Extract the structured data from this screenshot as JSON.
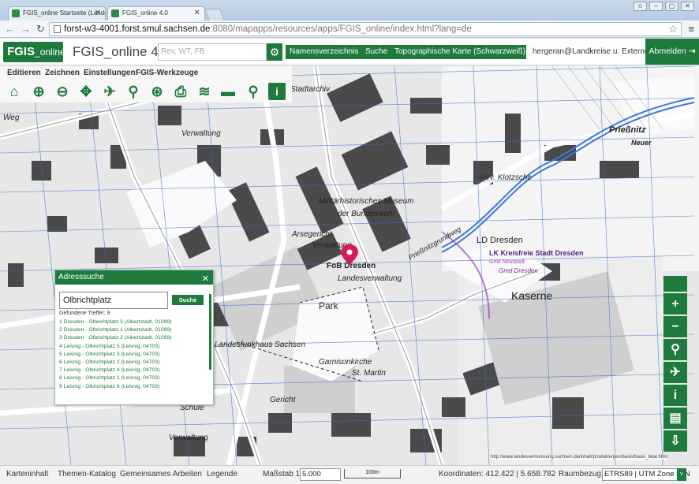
{
  "browser": {
    "tabs": [
      {
        "title": "FGIS_online Startseite (Landes",
        "active": false
      },
      {
        "title": "FGIS_online 4.0",
        "active": true
      }
    ],
    "url_host": "forst-w3-4001.forst.smul.sachsen.de",
    "url_path": ":8080/mapapps/resources/apps/FGIS_online/index.html?lang=de",
    "window_buttons": [
      "person-icon",
      "minimize-icon",
      "maximize-icon",
      "close-icon"
    ]
  },
  "header": {
    "logo_main": "FGIS",
    "logo_sub": "_online",
    "app_title": "FGIS_online 4.0",
    "search_placeholder": "Rev, WT, FB",
    "namensverzeichnis_label": "Namensverzeichnis",
    "suche_label": "Suche",
    "basemap_label": "Topographische Karte (Schwarzweiß)",
    "user": "hergeran@Landkreise u. Externe",
    "logout_label": "Abmelden"
  },
  "menu": {
    "items": [
      "Editieren",
      "Zeichnen",
      "Einstellungen",
      "FGIS-Werkzeuge"
    ]
  },
  "toolbar": {
    "tools": [
      "home-icon",
      "zoom-in-box-icon",
      "zoom-out-box-icon",
      "pan-icon",
      "extent-icon",
      "magnify-icon",
      "zoom-full-icon",
      "print-icon",
      "layers-add-icon",
      "measure-icon",
      "search-map-icon",
      "info-icon"
    ]
  },
  "map": {
    "labels": [
      "Weg",
      "Verwaltung",
      "Stadtarchiv",
      "Militärhistorisches Museum",
      "der Bundeswehr",
      "Arsegericht",
      "Verwaltung",
      "FoB Dresden",
      "Landesverwaltung",
      "Park",
      "Rev. Klotzsche",
      "LD Dresden",
      "LK Kreisfreie Stadt Dresden",
      "Gmk Neustadt",
      "Gmd Dresden",
      "Kaserne",
      "Prießnitz",
      "Neuer",
      "Garnisonkirche",
      "St. Martin",
      "Gericht",
      "Schule",
      "Verwaltung",
      "Landesfunkhaus Sachsen",
      "Prießnitzgrundweg"
    ],
    "marker_label": "FoB Dresden"
  },
  "zoom_controls": [
    "zoom-in-icon",
    "zoom-out-icon",
    "zoom-search-icon",
    "pan-map-icon",
    "info-map-icon",
    "identify-icon",
    "download-icon"
  ],
  "zoom_labels": [
    "+",
    "−"
  ],
  "address_search": {
    "title": "Adresssuche",
    "input_value": "Olbrichtplatz",
    "search_label": "Suche",
    "found_label": "Gefundene Treffer: 9",
    "results": [
      "1 Dresden - Olbrichtplatz 3 (Albertstadt, 01099)",
      "2 Dresden - Olbrichtplatz 1 (Albertstadt, 01099)",
      "3 Dresden - Olbrichtplatz 2 (Albertstadt, 01099)",
      "4 Leisnig - Olbrichtplatz 5 (Leisnig, 04703)",
      "5 Leisnig - Olbrichtplatz 3 (Leisnig, 04703)",
      "6 Leisnig - Olbrichtplatz 2 (Leisnig, 04703)",
      "7 Leisnig - Olbrichtplatz 4 (Leisnig, 04703)",
      "8 Leisnig - Olbrichtplatz 1 (Leisnig, 04703)",
      "9 Leisnig - Olbrichtplatz 6 (Leisnig, 04703)"
    ]
  },
  "statusbar": {
    "items": [
      "Karteninhalt",
      "Themen-Katalog",
      "Gemeinsames Arbeiten",
      "Legende"
    ],
    "scale_label": "Maßstab 1:",
    "scale_value": "5.000",
    "scalebar_label": "100m",
    "coords_label": "Koordinaten: 412.422 | 5.658.782",
    "crs_label": "Raumbezug:",
    "crs_value": "ETRS89 | UTM Zone 33N",
    "attribution": "http://www.landesvermessung.sachsen.de/inhalt/produkte/geo/basis/basis_bkat.html"
  },
  "colors": {
    "brand": "#1f7a3e",
    "marker": "#d6195f"
  }
}
